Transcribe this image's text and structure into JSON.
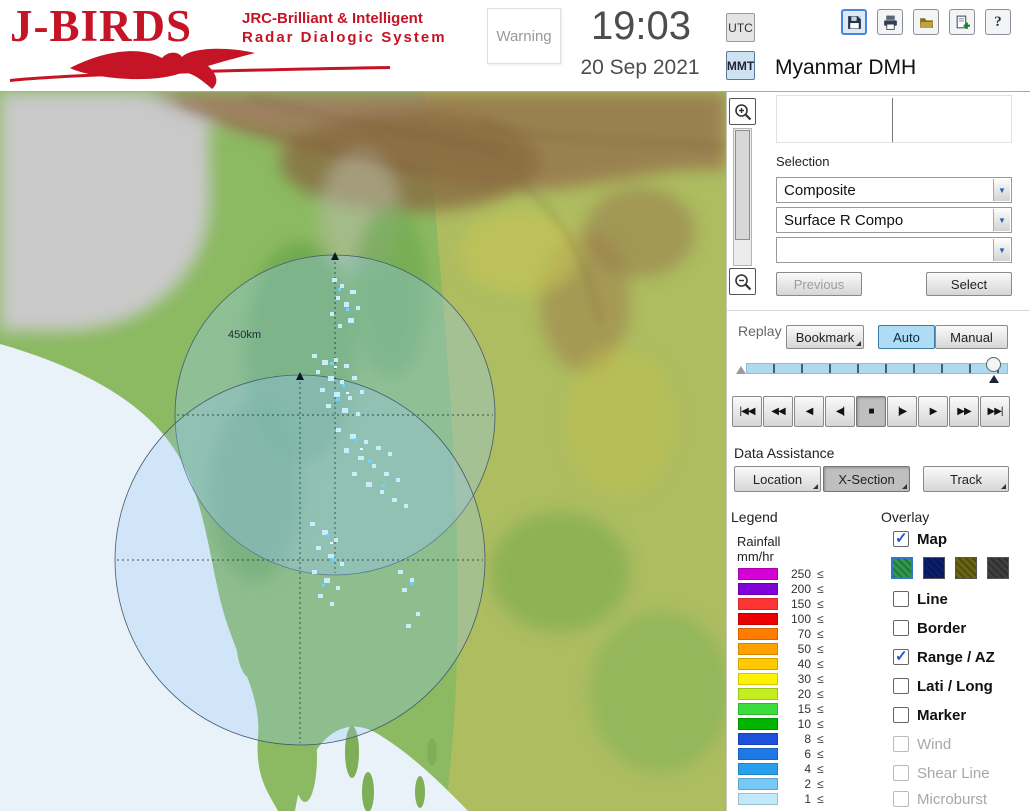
{
  "header": {
    "logo": {
      "title": "J-BIRDS",
      "subtitle1": "JRC-Brilliant & Intelligent",
      "subtitle2": "Radar  Dialogic  System"
    },
    "warning": "Warning",
    "clock": {
      "time": "19:03",
      "date": "20 Sep 2021"
    },
    "timezone": {
      "utc": "UTC",
      "mmt": "MMT",
      "mmt_selected": true
    },
    "station": "Myanmar DMH",
    "toolbar": {
      "icons": [
        "save-icon",
        "print-icon",
        "open-folder-icon",
        "export-icon",
        "help-icon"
      ],
      "help_glyph": "?"
    }
  },
  "map": {
    "range_label": "450km"
  },
  "selection": {
    "label": "Selection",
    "dropdowns": [
      {
        "value": "Composite"
      },
      {
        "value": "Surface R Compo"
      },
      {
        "value": ""
      }
    ],
    "previous": "Previous",
    "select": "Select",
    "previous_disabled": true
  },
  "replay": {
    "label": "Replay",
    "bookmark": "Bookmark",
    "auto": "Auto",
    "manual": "Manual",
    "auto_selected": true,
    "playback": [
      {
        "symbol": "|◀◀",
        "pressed": false
      },
      {
        "symbol": "◀◀",
        "pressed": false
      },
      {
        "symbol": "◀",
        "pressed": false
      },
      {
        "symbol": "◀|",
        "pressed": false
      },
      {
        "symbol": "■",
        "pressed": true
      },
      {
        "symbol": "|▶",
        "pressed": false
      },
      {
        "symbol": "▶",
        "pressed": false
      },
      {
        "symbol": "▶▶",
        "pressed": false
      },
      {
        "symbol": "▶▶|",
        "pressed": false
      }
    ]
  },
  "data_assistance": {
    "label": "Data Assistance",
    "buttons": [
      {
        "label": "Location",
        "pressed": false
      },
      {
        "label": "X-Section",
        "pressed": true
      },
      {
        "label": "Track",
        "pressed": false
      }
    ]
  },
  "legend": {
    "title": "Legend",
    "subtitle1": "Rainfall",
    "subtitle2": "mm/hr",
    "unit_suffix": "≤",
    "scale": [
      {
        "value": "250",
        "color": "#d400d4"
      },
      {
        "value": "200",
        "color": "#8000d8"
      },
      {
        "value": "150",
        "color": "#ff3434"
      },
      {
        "value": "100",
        "color": "#ec0000"
      },
      {
        "value": "70",
        "color": "#ff7c00"
      },
      {
        "value": "50",
        "color": "#ffa200"
      },
      {
        "value": "40",
        "color": "#ffc800"
      },
      {
        "value": "30",
        "color": "#fff200"
      },
      {
        "value": "20",
        "color": "#c4ee1e"
      },
      {
        "value": "15",
        "color": "#3cdc3c"
      },
      {
        "value": "10",
        "color": "#00b400"
      },
      {
        "value": "8",
        "color": "#1e50dc"
      },
      {
        "value": "6",
        "color": "#1e78e6"
      },
      {
        "value": "4",
        "color": "#28a0ee"
      },
      {
        "value": "2",
        "color": "#78c8f6"
      },
      {
        "value": "1",
        "color": "#c2e8fb"
      }
    ]
  },
  "overlay": {
    "title": "Overlay",
    "map_styles": [
      "#2f9a4f",
      "#0c1f6e",
      "#6b6414",
      "#3f3f3f"
    ],
    "items": [
      {
        "label": "Map",
        "checked": true,
        "disabled": false
      },
      {
        "label": "Line",
        "checked": false,
        "disabled": false
      },
      {
        "label": "Border",
        "checked": false,
        "disabled": false
      },
      {
        "label": "Range / AZ",
        "checked": true,
        "disabled": false
      },
      {
        "label": "Lati / Long",
        "checked": false,
        "disabled": false
      },
      {
        "label": "Marker",
        "checked": false,
        "disabled": false
      },
      {
        "label": "Wind",
        "checked": false,
        "disabled": true
      },
      {
        "label": "Shear Line",
        "checked": false,
        "disabled": true
      },
      {
        "label": "Microburst",
        "checked": false,
        "disabled": true
      }
    ]
  }
}
